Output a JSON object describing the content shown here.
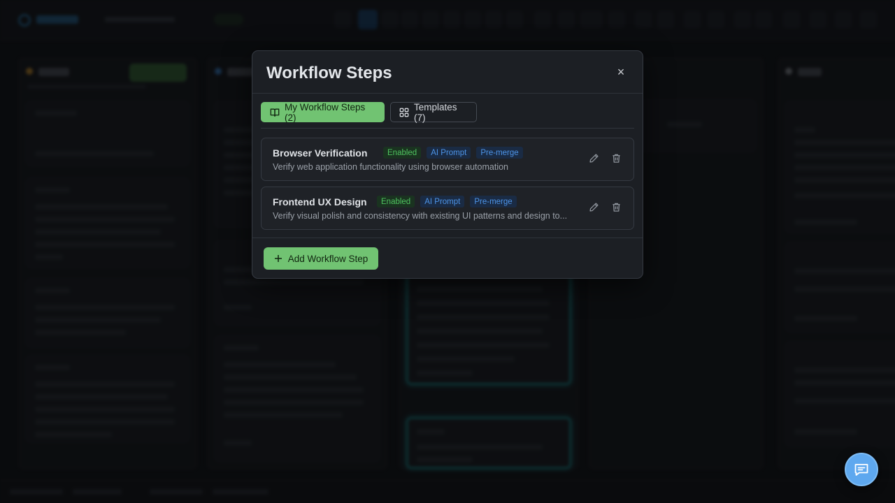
{
  "modal": {
    "title": "Workflow Steps",
    "close_label": "×",
    "tabs": [
      {
        "label": "My Workflow Steps (2)",
        "icon": "book-icon",
        "active": true
      },
      {
        "label": "Templates (7)",
        "icon": "grid-icon",
        "active": false
      }
    ],
    "steps": [
      {
        "name": "Browser Verification",
        "badges": [
          "Enabled",
          "AI Prompt",
          "Pre-merge"
        ],
        "description": "Verify web application functionality using browser automation"
      },
      {
        "name": "Frontend UX Design",
        "badges": [
          "Enabled",
          "AI Prompt",
          "Pre-merge"
        ],
        "description": "Verify visual polish and consistency with existing UI patterns and design to..."
      }
    ],
    "add_button_label": "Add Workflow Step"
  },
  "colors": {
    "accent_green": "#71c372",
    "badge_green_text": "#4fc25f",
    "badge_blue_text": "#4d94e8",
    "chat_fab": "#5ea8ef"
  },
  "chat_fab": {
    "icon": "chat-bubble-icon"
  }
}
